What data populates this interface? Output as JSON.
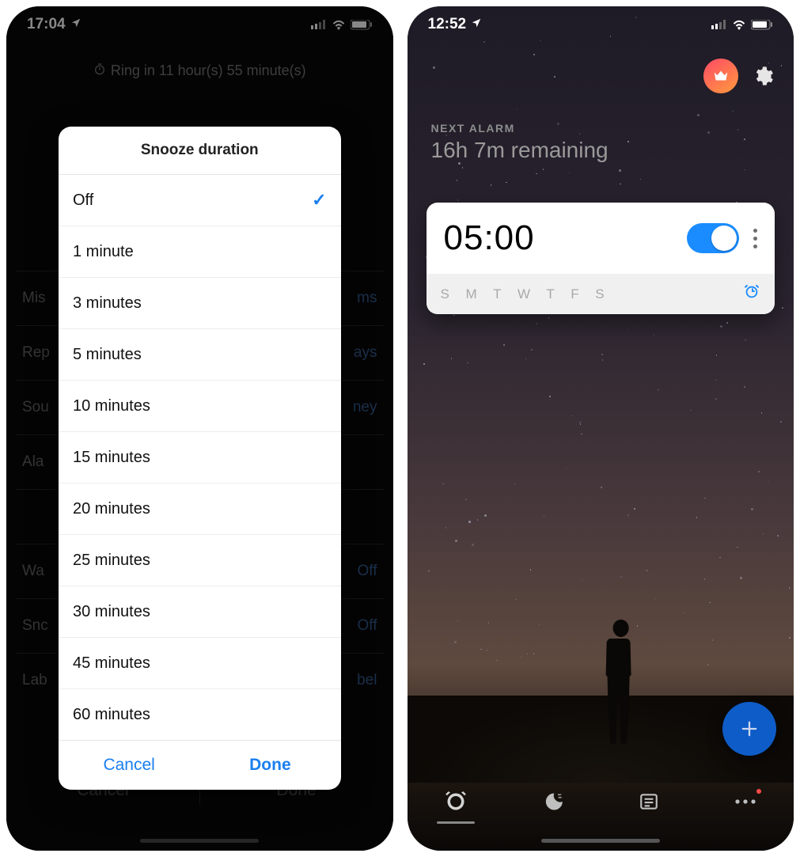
{
  "left": {
    "status": {
      "time": "17:04"
    },
    "ring_text": "Ring in 11 hour(s) 55 minute(s)",
    "bg_rows": [
      {
        "l": "Mis",
        "r": "ms"
      },
      {
        "l": "Rep",
        "r": "ays"
      },
      {
        "l": "Sou",
        "r": "ney"
      },
      {
        "l": "Ala",
        "r": ""
      },
      {
        "l": "",
        "r": ""
      },
      {
        "l": "Wa",
        "r": "Off"
      },
      {
        "l": "Snc",
        "r": "Off"
      },
      {
        "l": "Lab",
        "r": "bel"
      }
    ],
    "bottom": {
      "cancel": "Cancel",
      "done": "Done"
    },
    "sheet": {
      "title": "Snooze duration",
      "options": [
        {
          "label": "Off",
          "selected": true
        },
        {
          "label": "1 minute",
          "selected": false
        },
        {
          "label": "3 minutes",
          "selected": false
        },
        {
          "label": "5 minutes",
          "selected": false
        },
        {
          "label": "10 minutes",
          "selected": false
        },
        {
          "label": "15 minutes",
          "selected": false
        },
        {
          "label": "20 minutes",
          "selected": false
        },
        {
          "label": "25 minutes",
          "selected": false
        },
        {
          "label": "30 minutes",
          "selected": false
        },
        {
          "label": "45 minutes",
          "selected": false
        },
        {
          "label": "60 minutes",
          "selected": false
        }
      ],
      "cancel": "Cancel",
      "done": "Done"
    }
  },
  "right": {
    "status": {
      "time": "12:52"
    },
    "next_alarm": {
      "label": "NEXT ALARM",
      "value": "16h 7m remaining"
    },
    "alarm": {
      "time": "05:00",
      "enabled": true,
      "days": "S M T W T F S"
    }
  }
}
